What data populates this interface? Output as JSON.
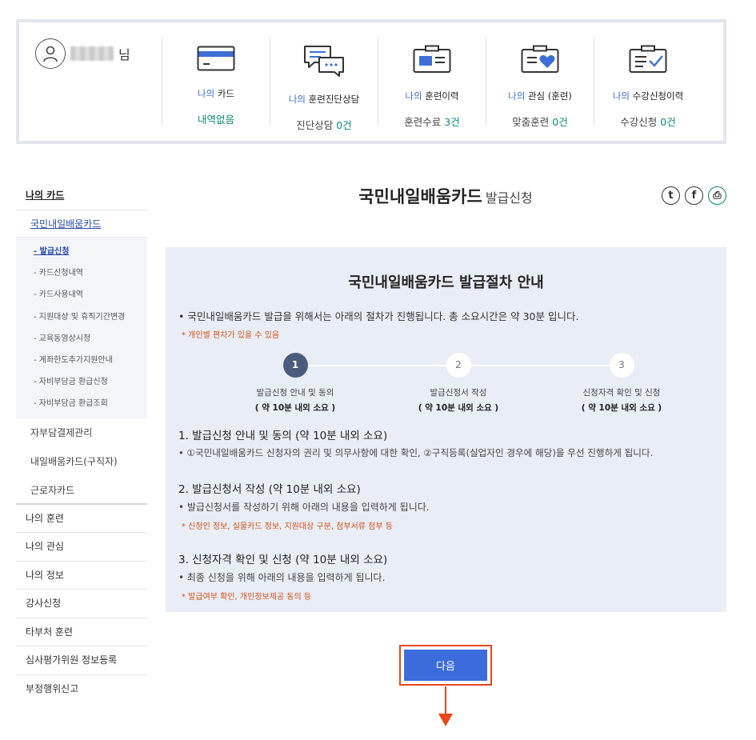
{
  "user": {
    "name_suffix": "님"
  },
  "stats": [
    {
      "prefix": "나의",
      "label": "카드",
      "value_text": "내역없음",
      "num": ""
    },
    {
      "prefix": "나의",
      "label": "훈련진단상담",
      "value_text": "진단상담",
      "num": "0건"
    },
    {
      "prefix": "나의",
      "label": "훈련이력",
      "value_text": "훈련수료",
      "num": "3건"
    },
    {
      "prefix": "나의",
      "label": "관심 (훈련)",
      "value_text": "맞춤훈련",
      "num": "0건"
    },
    {
      "prefix": "나의",
      "label": "수강신청이력",
      "value_text": "수강신청",
      "num": "0건"
    }
  ],
  "sidebar": {
    "title": "나의 카드",
    "active_sub": "국민내일배움카드",
    "deep_items": [
      "- 발급신청",
      "- 카드신청내역",
      "- 카드사용내역",
      "- 지원대상 및 휴직기간변경",
      "- 교육동영상시청",
      "- 계좌한도추가지원안내",
      "- 자비부담금 환급신청",
      "- 자비부담금 환급조회"
    ],
    "subs": [
      "자부담결제관리",
      "내일배움카드(구직자)",
      "근로자카드"
    ],
    "mains": [
      "나의 훈련",
      "나의 관심",
      "나의 정보",
      "강사신청",
      "타부처 훈련",
      "심사평가위원 정보등록",
      "부정행위신고"
    ]
  },
  "page": {
    "title": "국민내일배움카드",
    "subtitle": "발급신청"
  },
  "share": {
    "twitter": "t",
    "facebook": "f",
    "print": "⎙"
  },
  "guide": {
    "title": "국민내일배움카드 발급절차 안내",
    "intro": "• 국민내일배움카드 발급을 위해서는 아래의 절차가 진행됩니다. 총 소요시간은 약 30분 입니다.",
    "note": "* 개인별 편차가 있을 수 있음",
    "steps": [
      {
        "num": "1",
        "label": "발급신청 안내 및 동의",
        "time": "( 약 10분 내외 소요 )"
      },
      {
        "num": "2",
        "label": "발급신청서 작성",
        "time": "( 약 10분 내외 소요 )"
      },
      {
        "num": "3",
        "label": "신청자격 확인 및 신청",
        "time": "( 약 10분 내외 소요 )"
      }
    ],
    "sections": [
      {
        "title": "1. 발급신청 안내 및 동의 (약 10분 내외 소요)",
        "desc": "• ①국민내일배움카드 신청자의 권리 및 의무사항에 대한 확인, ②구직등록(실업자인 경우에 해당)을 우선 진행하게 됩니다.",
        "note": ""
      },
      {
        "title": "2. 발급신청서 작성 (약 10분 내외 소요)",
        "desc": "• 발급신청서를 작성하기 위해 아래의 내용을 입력하게 됩니다.",
        "note": "* 신청인 정보, 실물카드 정보, 지원대상 구분, 첨부서류 첨부 등"
      },
      {
        "title": "3. 신청자격 확인 및 신청 (약 10분 내외 소요)",
        "desc": "• 최종 신청을 위해 아래의 내용을 입력하게 됩니다.",
        "note": "* 발급여부 확인, 개인정보제공 동의 등"
      }
    ]
  },
  "next_button": "다음",
  "colors": {
    "accent": "#3c6cdc",
    "highlight": "#e8481a",
    "teal": "#0a8a7a",
    "box_bg": "#e9edf5"
  }
}
